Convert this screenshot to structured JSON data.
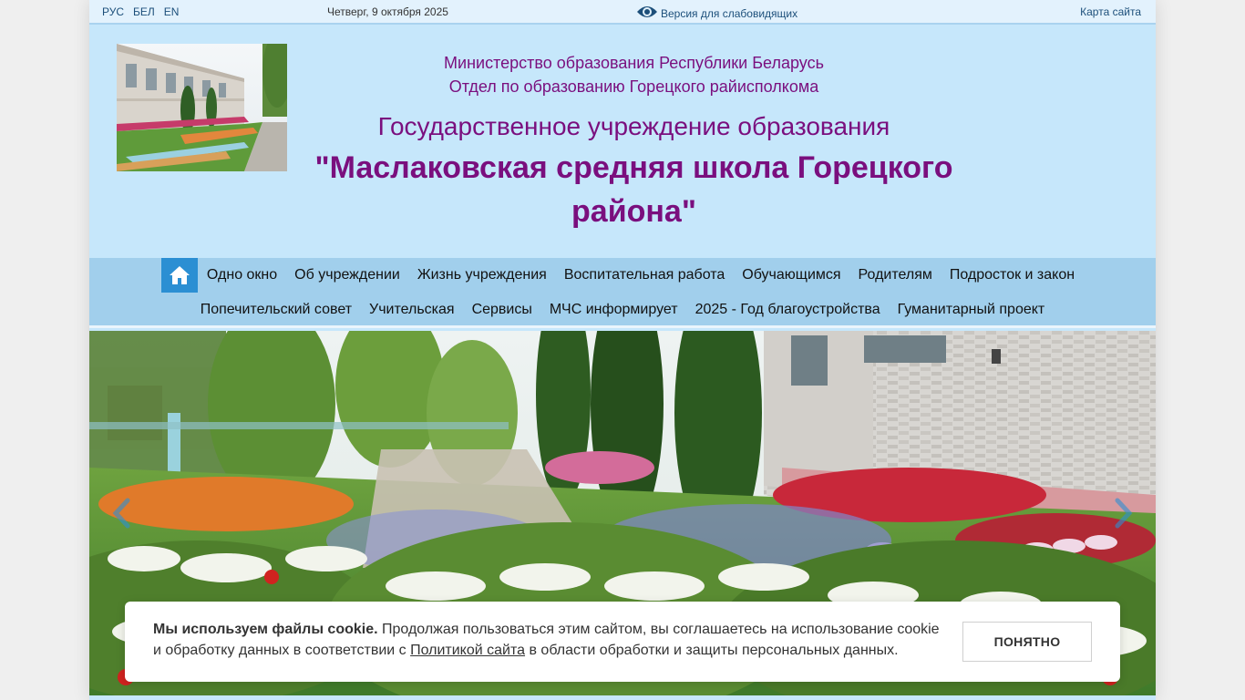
{
  "topbar": {
    "langs": [
      "РУС",
      "БЕЛ",
      "EN"
    ],
    "date": "Четверг, 9 октября 2025",
    "vision_label": "Версия для слабовидящих",
    "sitemap_label": "Карта сайта"
  },
  "header": {
    "ministry": "Министерство образования Республики Беларусь",
    "department": "Отдел по образованию Горецкого райисполкома",
    "org_type": "Государственное учреждение образования",
    "school_name": "\"Маслаковская средняя школа Горецкого района\""
  },
  "nav": {
    "row1": [
      "Одно окно",
      "Об учреждении",
      "Жизнь учреждения",
      "Воспитательная работа",
      "Обучающимся",
      "Родителям",
      "Подросток и закон"
    ],
    "row2": [
      "Попечительский совет",
      "Учительская",
      "Сервисы",
      "МЧС информирует",
      "2025 - Год благоустройства",
      "Гуманитарный проект"
    ]
  },
  "cookie": {
    "bold": "Мы используем файлы cookie.",
    "text_before_link": " Продолжая пользоваться этим сайтом, вы соглашаетесь на использование cookie и обработку данных в соответствии с ",
    "link": "Политикой сайта",
    "text_after_link": " в области обработки и защиты персональных данных.",
    "button": "ПОНЯТНО"
  },
  "colors": {
    "page_bg": "#c6e7fb",
    "title_purple": "#7a0f7e",
    "nav_bg": "#a1cfec",
    "home_button": "#2b8fd3"
  },
  "icons": {
    "vision": "eye-icon",
    "home": "home-icon",
    "prev": "chevron-left-icon",
    "next": "chevron-right-icon"
  }
}
